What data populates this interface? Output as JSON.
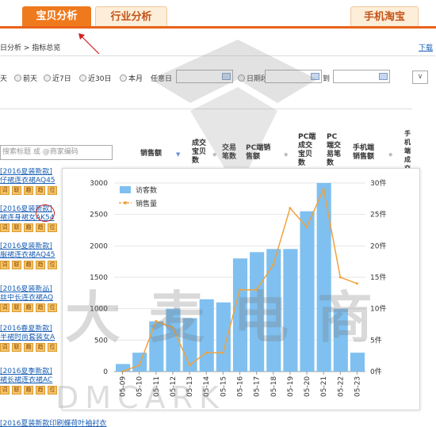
{
  "tabs": {
    "baobei": "宝贝分析",
    "industry": "行业分析",
    "mobile": "手机淘宝"
  },
  "breadcrumb": "日分析 > 指标总览",
  "download": "下载",
  "date_filter": {
    "options": [
      "天",
      "前天",
      "近7日",
      "近30日",
      "本月",
      "任意日"
    ],
    "start_label": "日期段",
    "to_label": "到"
  },
  "search_placeholder": "搜索标题 或 @商家编码",
  "headers": {
    "sales": "销售额",
    "deal_items": "成交宝贝数",
    "trade_count": "交易笔数",
    "pc_sales": "PC端销售额",
    "pc_deal_items": "PC端成交宝贝数",
    "pc_trade": "PC端交易笔数",
    "mobile_sales": "手机端销售额",
    "mobile_deal_items": "手机端成交宝贝数"
  },
  "products": [
    {
      "title": "[2016夏装新款]",
      "sub": "仔裙连衣裙AQ45"
    },
    {
      "title": "[2016夏装新款]",
      "sub": "裙连身裙女AK54"
    },
    {
      "title": "[2016夏装新款]",
      "sub": "服裙连衣裙AQ45"
    },
    {
      "title": "[2016夏装新品]",
      "sub": "丝中长连衣裙AQ"
    },
    {
      "title": "[2016春夏新款]",
      "sub": "半裙时尚套装女A"
    },
    {
      "title": "[2016夏季新款]",
      "sub": "裙长裙连衣裙AC"
    }
  ],
  "badge_labels": [
    "词",
    "联",
    "趣",
    "趋",
    "位"
  ],
  "bottom_row": "[2016夏装新款印刷蝶荷叶袖衬衣",
  "watermark": {
    "main": "大麦电商",
    "sub": "DMCARK"
  },
  "chart_data": {
    "type": "bar",
    "categories": [
      "05-09",
      "05-10",
      "05-11",
      "05-12",
      "05-13",
      "05-14",
      "05-15",
      "05-16",
      "05-17",
      "05-18",
      "05-19",
      "05-20",
      "05-21",
      "05-22",
      "05-23"
    ],
    "series": [
      {
        "name": "访客数",
        "type": "bar",
        "axis": "left",
        "values": [
          120,
          300,
          800,
          1000,
          850,
          1150,
          1100,
          1800,
          1900,
          1950,
          1950,
          2550,
          3000,
          1000,
          300
        ]
      },
      {
        "name": "销售量",
        "type": "line",
        "axis": "right",
        "values": [
          0,
          1,
          8,
          7,
          1,
          3,
          3,
          13,
          13,
          17,
          26,
          23,
          29,
          15,
          14
        ]
      }
    ],
    "ylim_left": [
      0,
      3000
    ],
    "yticks_left": [
      "0",
      "500",
      "1000",
      "1500",
      "2000",
      "2500",
      "3000"
    ],
    "ylim_right": [
      0,
      30
    ],
    "yticks_right": [
      "0件",
      "5件",
      "10件",
      "15件",
      "20件",
      "25件",
      "30件"
    ],
    "colors": {
      "bar": "#7fc0f0",
      "line": "#f0a23c"
    },
    "legend": "top-left",
    "grid": true
  }
}
